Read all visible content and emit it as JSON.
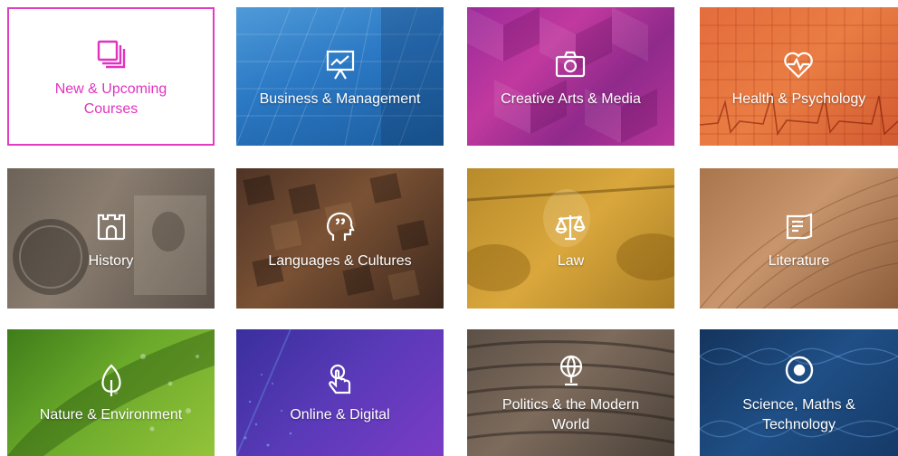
{
  "tiles": [
    {
      "label": "New & Upcoming Courses",
      "icon": "stacked-squares-icon"
    },
    {
      "label": "Business & Management",
      "icon": "presentation-board-icon"
    },
    {
      "label": "Creative Arts & Media",
      "icon": "camera-icon"
    },
    {
      "label": "Health & Psychology",
      "icon": "heart-pulse-icon"
    },
    {
      "label": "History",
      "icon": "castle-icon"
    },
    {
      "label": "Languages & Cultures",
      "icon": "speaking-head-icon"
    },
    {
      "label": "Law",
      "icon": "scales-icon"
    },
    {
      "label": "Literature",
      "icon": "book-icon"
    },
    {
      "label": "Nature & Environment",
      "icon": "leaf-icon"
    },
    {
      "label": "Online & Digital",
      "icon": "touch-hand-icon"
    },
    {
      "label": "Politics & the Modern World",
      "icon": "globe-icon"
    },
    {
      "label": "Science, Maths & Technology",
      "icon": "atom-icon"
    }
  ],
  "colors": {
    "accent": "#e033c0"
  }
}
